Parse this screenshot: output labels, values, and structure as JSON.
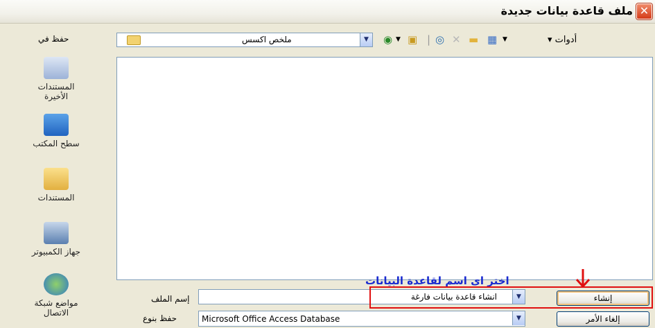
{
  "window": {
    "title": "ملف قاعدة بيانات جديدة"
  },
  "toolbar": {
    "save_in_label": "حفظ في",
    "location": "ملخص اكسس",
    "tools_menu": "أدوات"
  },
  "places": [
    {
      "label": "المستندات الأخيرة",
      "icon": "recent-documents-icon"
    },
    {
      "label": "سطح المكتب",
      "icon": "desktop-icon"
    },
    {
      "label": "المستندات",
      "icon": "my-documents-icon"
    },
    {
      "label": "جهاز الكمبيوتر",
      "icon": "my-computer-icon"
    },
    {
      "label": "مواضع شبكة الاتصال",
      "icon": "network-places-icon"
    }
  ],
  "form": {
    "filename_label": "إسم الملف",
    "filename_value": "انشاء قاعدة بيانات فارغة",
    "filetype_label": "حفظ بنوع",
    "filetype_value": "Microsoft Office Access Database"
  },
  "buttons": {
    "create": "إنشاء",
    "cancel": "إلغاء الأمر"
  },
  "annotation": {
    "text": "اختر اى اسم لقاعدة البيانات"
  },
  "colors": {
    "annotation": "#1A2BD0",
    "highlight": "#E01010",
    "dialog_bg": "#ECE9D8"
  }
}
